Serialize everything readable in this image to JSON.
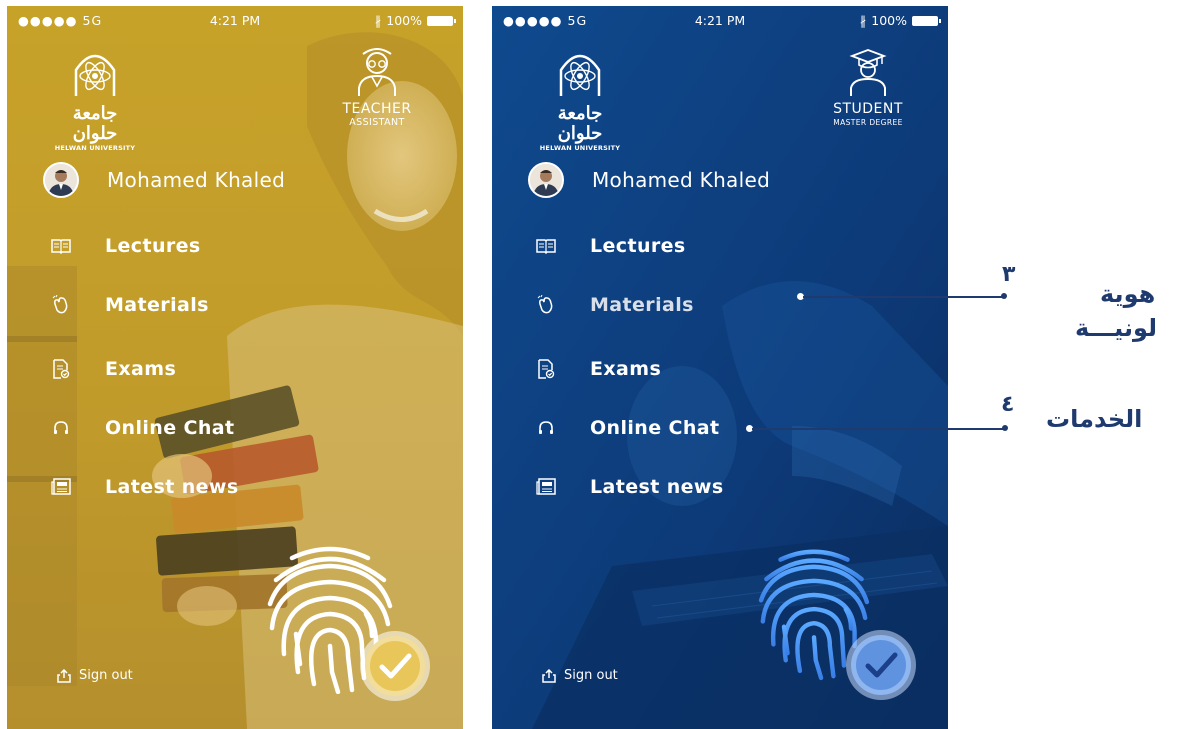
{
  "status_bar": {
    "signal": "●●●●● 5G",
    "time": "4:21 PM",
    "battery": "100%"
  },
  "university": {
    "arabic_name": "جامعة حلوان",
    "english_name": "HELWAN UNIVERSITY"
  },
  "user": {
    "name": "Mohamed Khaled"
  },
  "menu": {
    "lectures": "Lectures",
    "materials": "Materials",
    "exams": "Exams",
    "online_chat": "Online Chat",
    "latest_news": "Latest news"
  },
  "sign_out": "Sign out",
  "teacher_screen": {
    "role_title": "TEACHER",
    "role_subtitle": "ASSISTANT",
    "theme_color": "#c9a227"
  },
  "student_screen": {
    "role_title": "STUDENT",
    "role_subtitle": "MASTER DEGREE",
    "theme_color": "#0d3a78"
  },
  "annotations": [
    {
      "number": "٣",
      "label_line1": "هوية",
      "label_line2": "لونيـــة"
    },
    {
      "number": "٤",
      "label_line1": "الخدمات"
    }
  ]
}
